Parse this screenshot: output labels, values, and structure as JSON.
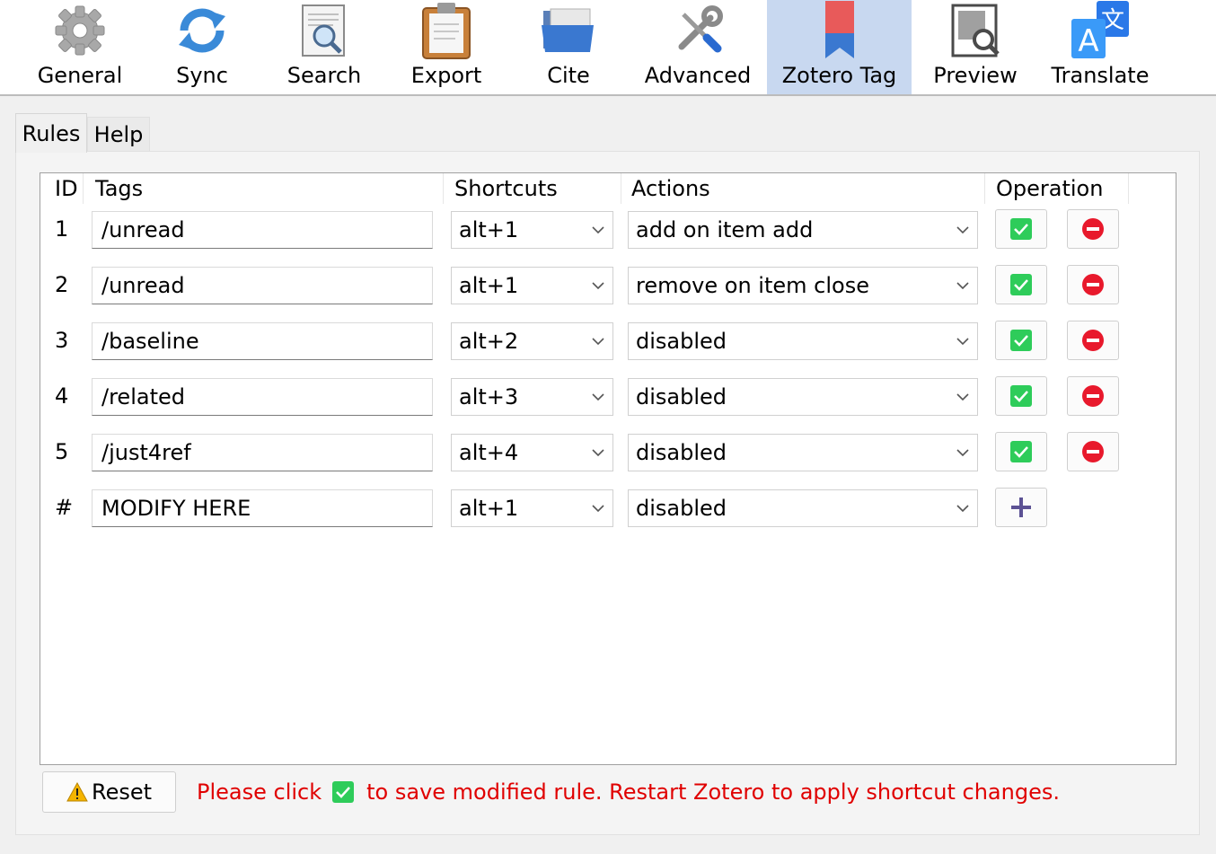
{
  "toolbar": {
    "items": [
      {
        "label": "General",
        "icon": "gear-icon"
      },
      {
        "label": "Sync",
        "icon": "sync-icon"
      },
      {
        "label": "Search",
        "icon": "search-document-icon"
      },
      {
        "label": "Export",
        "icon": "clipboard-icon"
      },
      {
        "label": "Cite",
        "icon": "folder-icon"
      },
      {
        "label": "Advanced",
        "icon": "wrench-screwdriver-icon"
      },
      {
        "label": "Zotero Tag",
        "icon": "bookmark-icon",
        "selected": true
      },
      {
        "label": "Preview",
        "icon": "preview-icon"
      },
      {
        "label": "Translate",
        "icon": "translate-icon"
      }
    ]
  },
  "tabs": {
    "rules": "Rules",
    "help": "Help",
    "selected": "Rules"
  },
  "table": {
    "headers": {
      "id": "ID",
      "tags": "Tags",
      "shortcuts": "Shortcuts",
      "actions": "Actions",
      "operation": "Operation"
    },
    "rows": [
      {
        "id": "1",
        "tag": "/unread",
        "shortcut": "alt+1",
        "action": "add on item add"
      },
      {
        "id": "2",
        "tag": "/unread",
        "shortcut": "alt+1",
        "action": "remove on item close"
      },
      {
        "id": "3",
        "tag": "/baseline",
        "shortcut": "alt+2",
        "action": "disabled"
      },
      {
        "id": "4",
        "tag": "/related",
        "shortcut": "alt+3",
        "action": "disabled"
      },
      {
        "id": "5",
        "tag": "/just4ref",
        "shortcut": "alt+4",
        "action": "disabled"
      }
    ],
    "new_row": {
      "id": "#",
      "tag": "MODIFY HERE",
      "shortcut": "alt+1",
      "action": "disabled"
    }
  },
  "footer": {
    "reset_label": "Reset",
    "notice_before": "Please click",
    "notice_after": "to save modified rule. Restart Zotero to apply shortcut changes."
  },
  "colors": {
    "accent_selected": "#c8d8f0",
    "save_green": "#2ecc5a",
    "delete_red": "#e8192c",
    "add_purple": "#5c5294",
    "notice_red": "#e00000"
  }
}
